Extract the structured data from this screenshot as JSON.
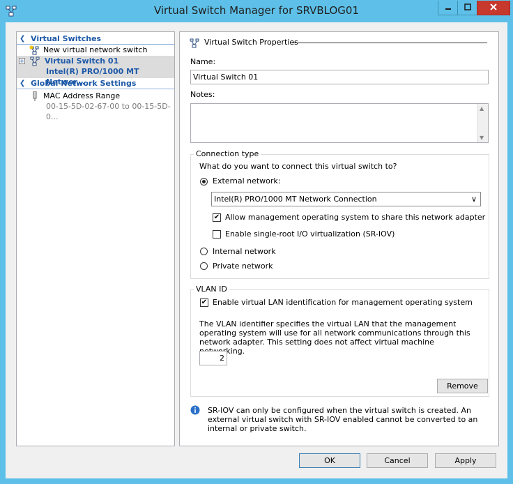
{
  "window": {
    "title": "Virtual Switch Manager for SRVBLOG01",
    "app_icon": "hyperv-network-icon"
  },
  "caption_buttons": {
    "minimize": "minimize-icon",
    "maximize": "maximize-icon",
    "close": "close-icon"
  },
  "tree": {
    "virtual_switches_header": "Virtual Switches",
    "new_switch": "New virtual network switch",
    "switch_name": "Virtual Switch 01",
    "switch_adapter": "Intel(R) PRO/1000 MT Networ...",
    "global_header": "Global Network Settings",
    "mac_label": "MAC Address Range",
    "mac_range": "00-15-5D-02-67-00 to 00-15-5D-0..."
  },
  "properties": {
    "heading": "Virtual Switch Properties",
    "name_label": "Name:",
    "name_value": "Virtual Switch 01",
    "notes_label": "Notes:",
    "notes_value": ""
  },
  "connection": {
    "group_title": "Connection type",
    "question": "What do you want to connect this virtual switch to?",
    "external_label": "External network:",
    "external_checked": true,
    "adapter_selected": "Intel(R) PRO/1000 MT Network Connection",
    "allow_mgmt_label": "Allow management operating system to share this network adapter",
    "allow_mgmt_checked": true,
    "sriov_label": "Enable single-root I/O virtualization (SR-IOV)",
    "sriov_checked": false,
    "internal_label": "Internal network",
    "private_label": "Private network"
  },
  "vlan": {
    "group_title": "VLAN ID",
    "enable_label": "Enable virtual LAN identification for management operating system",
    "enable_checked": true,
    "description": "The VLAN identifier specifies the virtual LAN that the management operating system will use for all network communications through this network adapter. This setting does not affect virtual machine networking.",
    "vlan_value": "2"
  },
  "remove_label": "Remove",
  "info_text": "SR-IOV can only be configured when the virtual switch is created. An external virtual switch with SR-IOV enabled cannot be converted to an internal or private switch.",
  "footer": {
    "ok": "OK",
    "cancel": "Cancel",
    "apply": "Apply"
  },
  "colors": {
    "title_bar": "#5ec0e8",
    "close_button": "#c7382d",
    "accent_text": "#1e5aa8",
    "panel_bg": "#f0f0f0"
  }
}
